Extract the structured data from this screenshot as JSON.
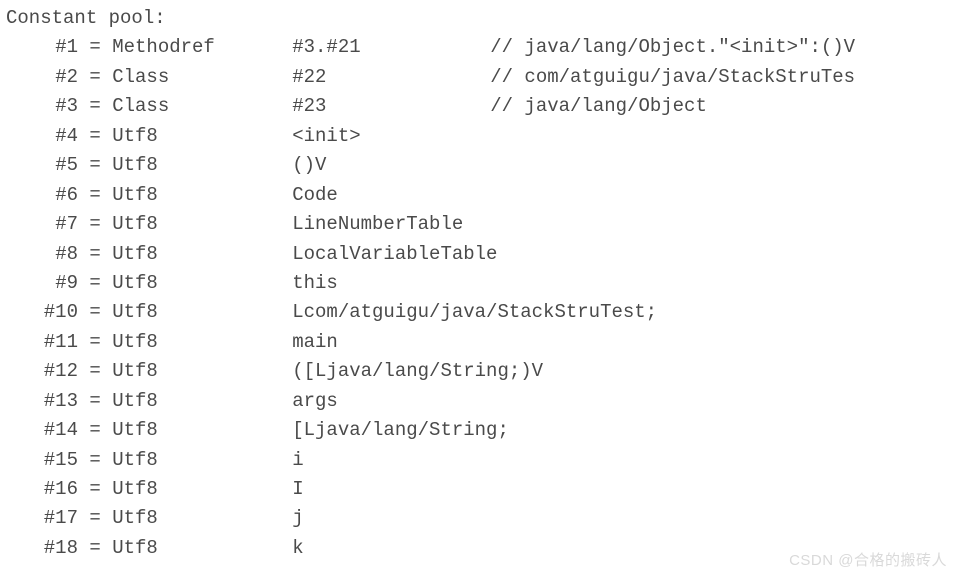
{
  "header": "Constant pool:",
  "entries": [
    {
      "idx": "#1",
      "kind": "Methodref",
      "value": "#3.#21",
      "comment": "// java/lang/Object.\"<init>\":()V"
    },
    {
      "idx": "#2",
      "kind": "Class",
      "value": "#22",
      "comment": "// com/atguigu/java/StackStruTes"
    },
    {
      "idx": "#3",
      "kind": "Class",
      "value": "#23",
      "comment": "// java/lang/Object"
    },
    {
      "idx": "#4",
      "kind": "Utf8",
      "value": "<init>",
      "comment": ""
    },
    {
      "idx": "#5",
      "kind": "Utf8",
      "value": "()V",
      "comment": ""
    },
    {
      "idx": "#6",
      "kind": "Utf8",
      "value": "Code",
      "comment": ""
    },
    {
      "idx": "#7",
      "kind": "Utf8",
      "value": "LineNumberTable",
      "comment": ""
    },
    {
      "idx": "#8",
      "kind": "Utf8",
      "value": "LocalVariableTable",
      "comment": ""
    },
    {
      "idx": "#9",
      "kind": "Utf8",
      "value": "this",
      "comment": ""
    },
    {
      "idx": "#10",
      "kind": "Utf8",
      "value": "Lcom/atguigu/java/StackStruTest;",
      "comment": ""
    },
    {
      "idx": "#11",
      "kind": "Utf8",
      "value": "main",
      "comment": ""
    },
    {
      "idx": "#12",
      "kind": "Utf8",
      "value": "([Ljava/lang/String;)V",
      "comment": ""
    },
    {
      "idx": "#13",
      "kind": "Utf8",
      "value": "args",
      "comment": ""
    },
    {
      "idx": "#14",
      "kind": "Utf8",
      "value": "[Ljava/lang/String;",
      "comment": ""
    },
    {
      "idx": "#15",
      "kind": "Utf8",
      "value": "i",
      "comment": ""
    },
    {
      "idx": "#16",
      "kind": "Utf8",
      "value": "I",
      "comment": ""
    },
    {
      "idx": "#17",
      "kind": "Utf8",
      "value": "j",
      "comment": ""
    },
    {
      "idx": "#18",
      "kind": "Utf8",
      "value": "k",
      "comment": ""
    }
  ],
  "watermark": "CSDN @合格的搬砖人"
}
